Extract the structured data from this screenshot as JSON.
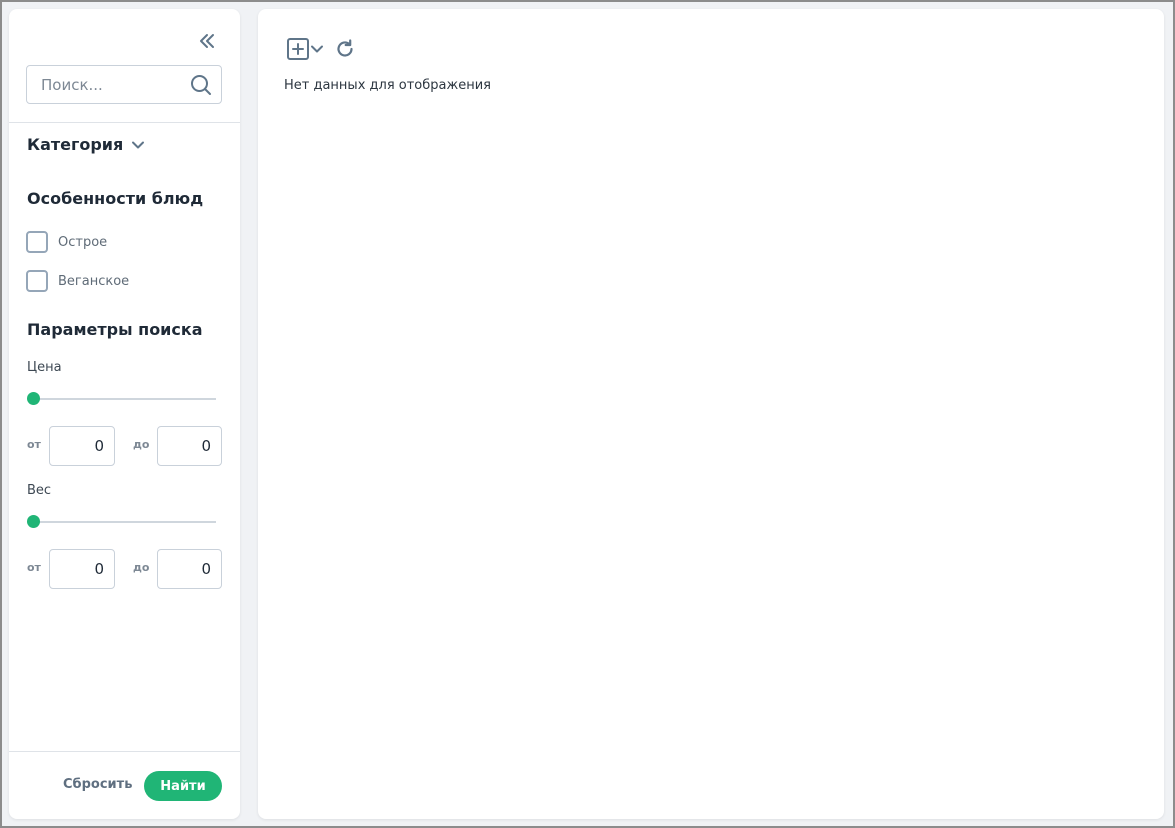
{
  "sidebar": {
    "search": {
      "placeholder": "Поиск...",
      "value": ""
    },
    "category": {
      "label": "Категория"
    },
    "features": {
      "title": "Особенности блюд",
      "options": [
        {
          "label": "Острое",
          "checked": false
        },
        {
          "label": "Веганское",
          "checked": false
        }
      ]
    },
    "params": {
      "title": "Параметры поиска",
      "price": {
        "label": "Цена",
        "from_prefix": "от",
        "to_prefix": "до",
        "from": "0",
        "to": "0",
        "slider_level": 0
      },
      "weight": {
        "label": "Вес",
        "from_prefix": "от",
        "to_prefix": "до",
        "from": "0",
        "to": "0",
        "slider_level": 0
      }
    },
    "footer": {
      "reset_label": "Сбросить",
      "find_label": "Найти"
    }
  },
  "main": {
    "empty_message": "Нет данных для отображения"
  },
  "colors": {
    "accent": "#20b576",
    "icon": "#5f7589",
    "background": "#f0f2f5"
  },
  "icons": [
    "collapse-double-chevron-left-icon",
    "search-icon",
    "chevron-down-icon",
    "add-square-icon",
    "refresh-icon"
  ]
}
